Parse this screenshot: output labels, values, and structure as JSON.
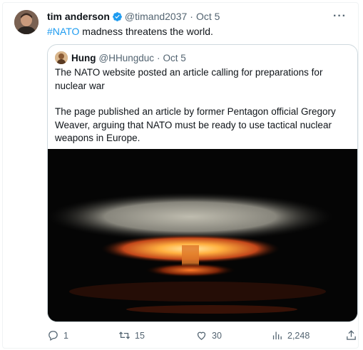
{
  "tweet": {
    "author_name": "tim anderson",
    "handle": "@timand2037",
    "separator": "·",
    "date": "Oct 5",
    "hashtag": "#NATO",
    "text_rest": " madness threatens the world.",
    "more_label": "···"
  },
  "quote": {
    "author_name": "Hung",
    "handle": "@HHungduc",
    "separator": "·",
    "date": "Oct 5",
    "paragraph_1": "The NATO website posted an article calling for preparations for nuclear war",
    "paragraph_2": "The page published an article by former Pentagon official Gregory Weaver, arguing that NATO must be ready to use tactical nuclear weapons in Europe."
  },
  "actions": {
    "replies": "1",
    "retweets": "15",
    "likes": "30",
    "views": "2,248"
  },
  "colors": {
    "accent": "#1d9bf0",
    "muted": "#536471",
    "text": "#0f1419"
  },
  "icons": {
    "verified": "verified-badge-icon",
    "reply": "reply-icon",
    "retweet": "retweet-icon",
    "like": "heart-icon",
    "views": "views-icon",
    "share": "share-icon"
  }
}
